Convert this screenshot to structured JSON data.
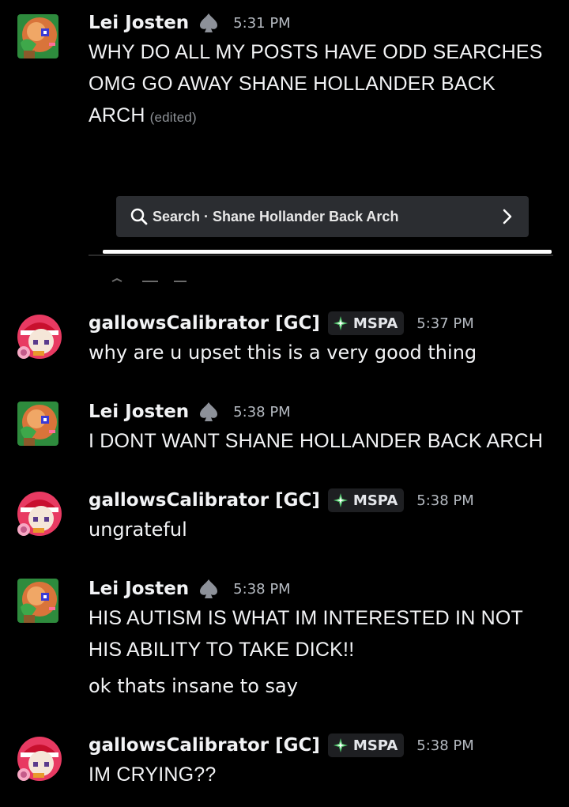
{
  "messages": [
    {
      "user": "Lei Josten",
      "time": "5:31 PM",
      "lines": [
        "WHY DO ALL MY POSTS HAVE ODD SEARCHES",
        "OMG GO AWAY SHANE HOLLANDER BACK",
        "ARCH"
      ],
      "edited": "(edited)"
    },
    {
      "user": "gallowsCalibrator [GC]",
      "tag": "MSPA",
      "time": "5:37 PM",
      "lines": [
        "why are u upset this is a very good thing"
      ]
    },
    {
      "user": "Lei Josten",
      "time": "5:38 PM",
      "lines": [
        "I DONT WANT SHANE HOLLANDER BACK ARCH"
      ]
    },
    {
      "user": "gallowsCalibrator [GC]",
      "tag": "MSPA",
      "time": "5:38 PM",
      "lines": [
        "ungrateful"
      ]
    },
    {
      "user": "Lei Josten",
      "time": "5:38 PM",
      "lines": [
        "HIS AUTISM IS WHAT IM INTERESTED IN NOT",
        "HIS ABILITY TO TAKE DICK!!"
      ],
      "followup": "ok thats insane to say"
    },
    {
      "user": "gallowsCalibrator [GC]",
      "tag": "MSPA",
      "time": "5:38 PM",
      "lines": [
        "IM CRYING??"
      ]
    }
  ],
  "search_embed": {
    "label": "Search · Shane Hollander Back Arch"
  },
  "icons": {
    "lei_avatar": "pixel-cookie-avatar-icon",
    "gc_avatar": "pixel-santa-avatar-icon",
    "role": "spade-icon",
    "tag": "sparkle-icon",
    "search": "search-icon",
    "chevron": "chevron-right-icon"
  },
  "colors": {
    "background": "#000000",
    "username": "#f2f3f5",
    "timestamp": "#b5bac1",
    "tag_bg": "#1e1f22",
    "tag_icon": "#4fc76b",
    "embed_bg": "#2b2d31"
  }
}
